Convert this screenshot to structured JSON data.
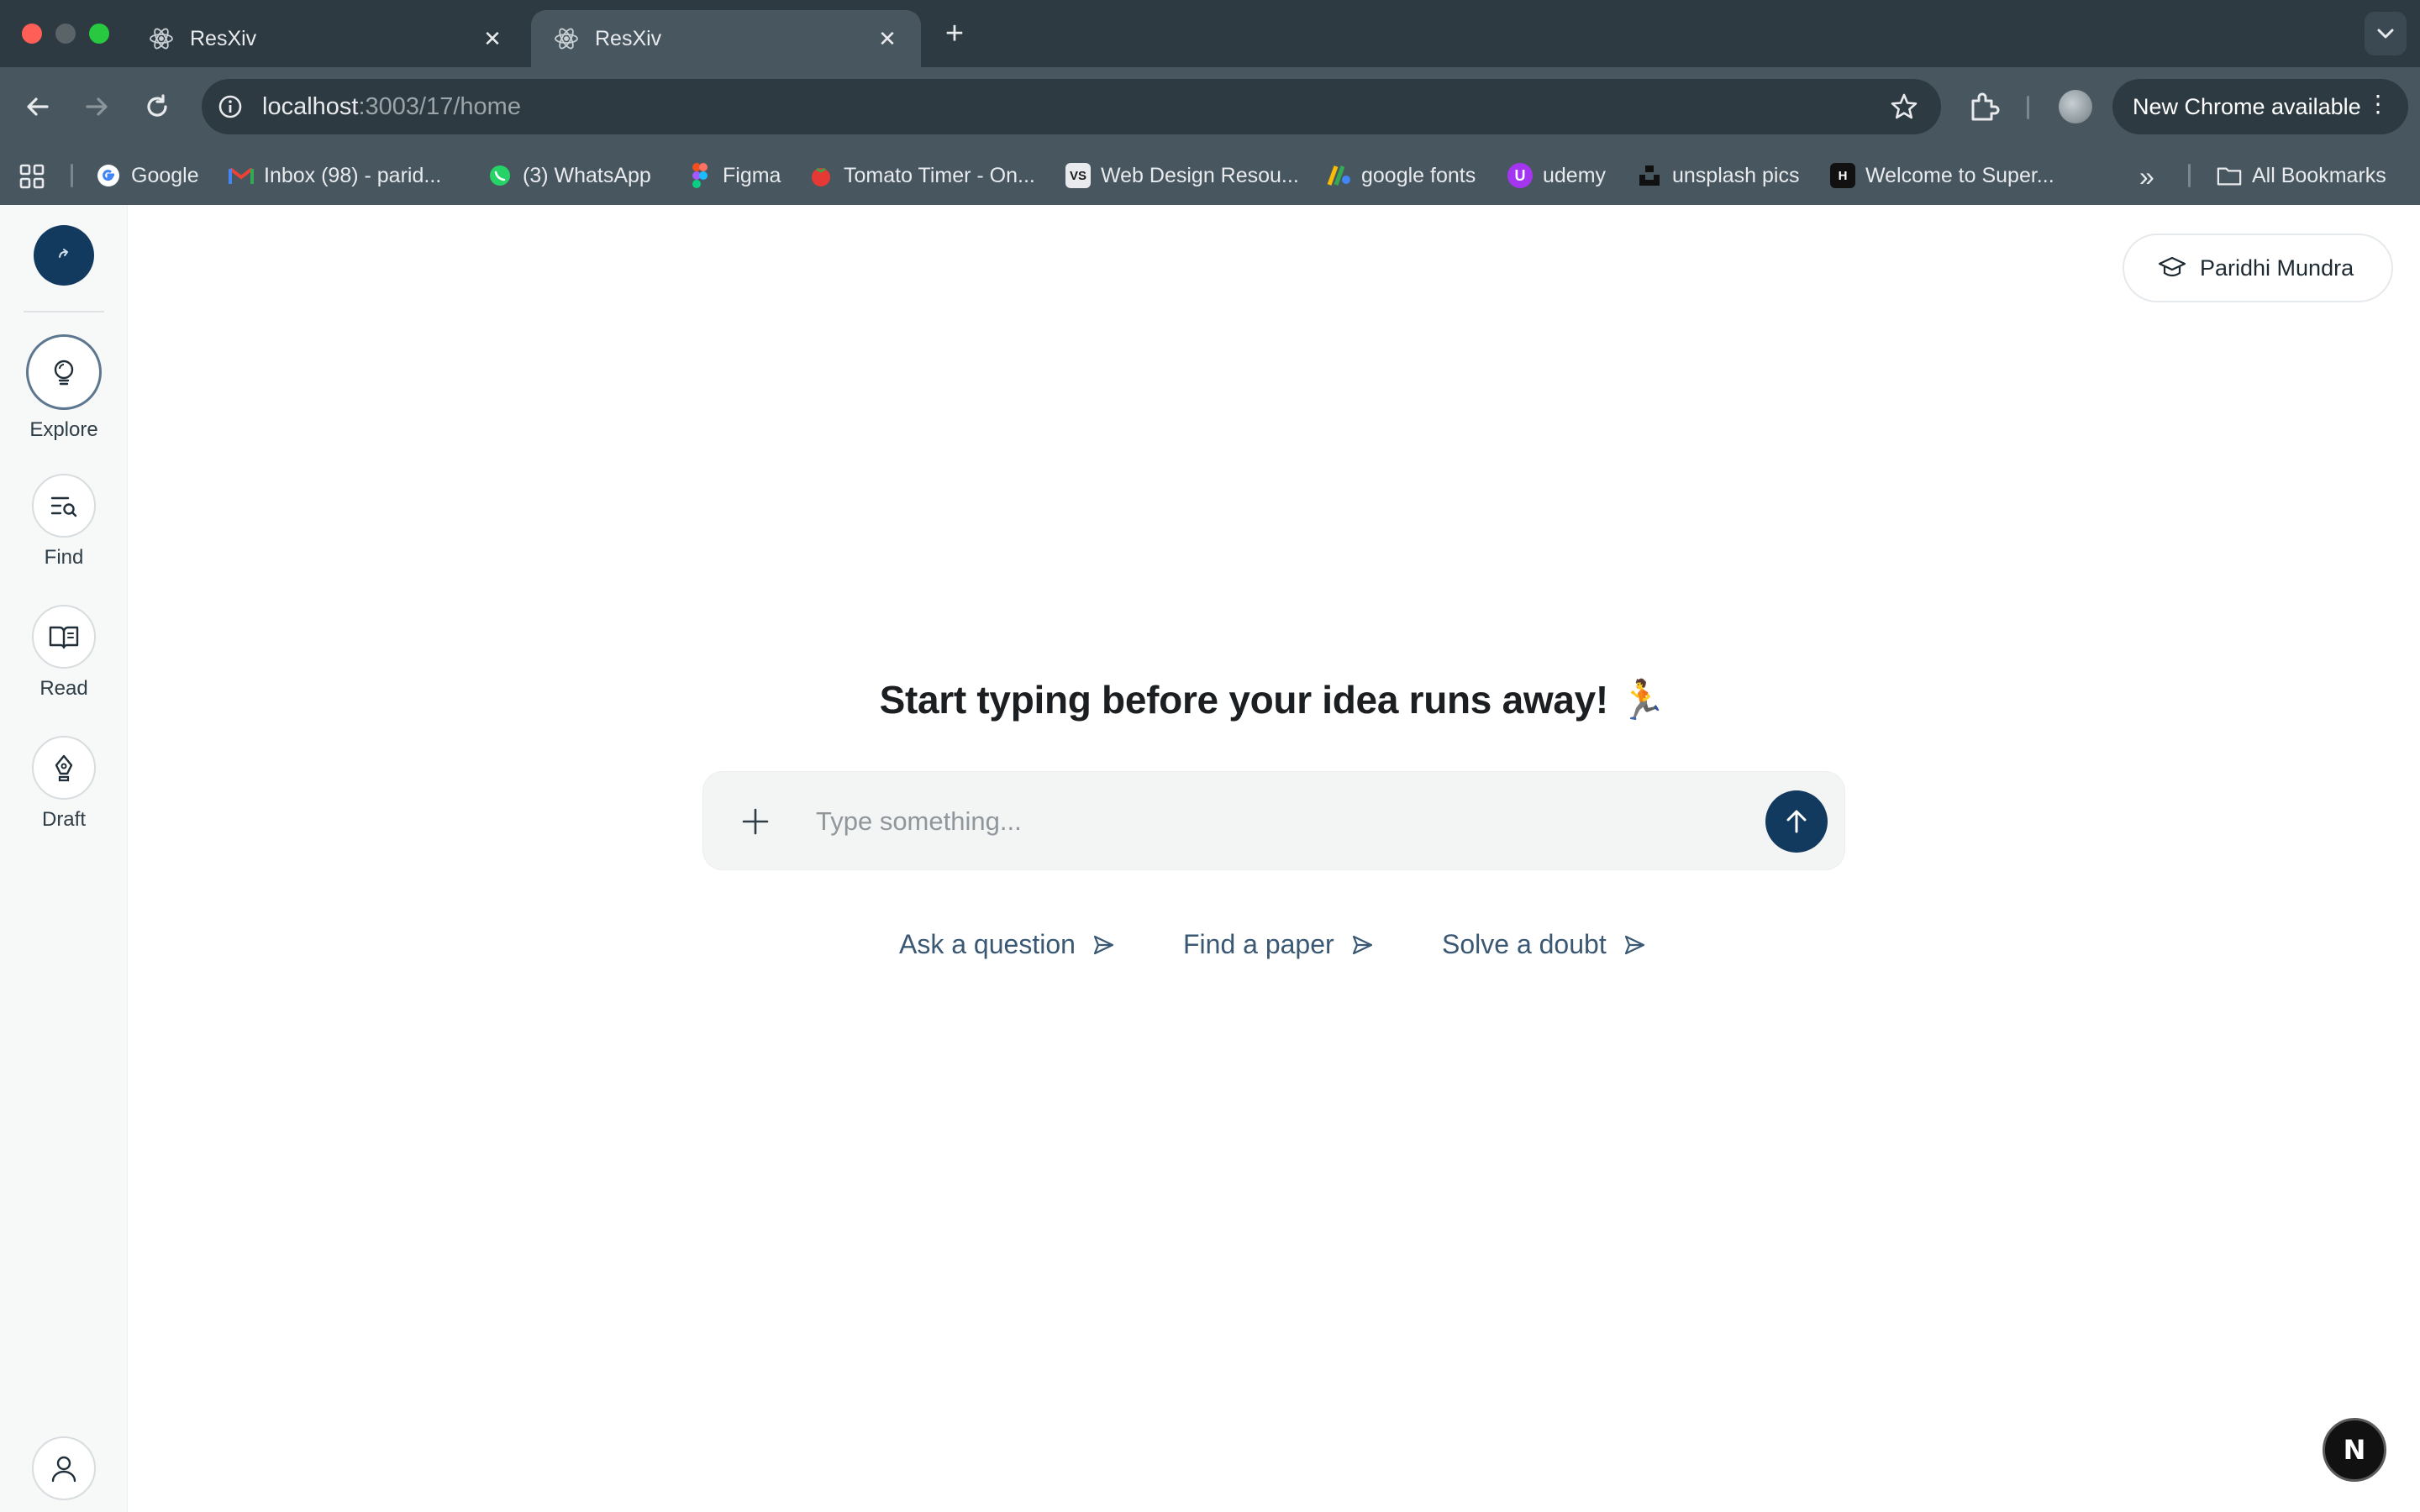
{
  "browser": {
    "tabs": [
      {
        "title": "ResXiv",
        "active": false
      },
      {
        "title": "ResXiv",
        "active": true
      }
    ],
    "url_host": "localhost",
    "url_path": ":3003/17/home",
    "update_label": "New Chrome available",
    "bookmarks": [
      {
        "label": "Google",
        "icon": "google-icon"
      },
      {
        "label": "Inbox (98) - parid...",
        "icon": "gmail-icon"
      },
      {
        "label": "(3) WhatsApp",
        "icon": "whatsapp-icon"
      },
      {
        "label": "Figma",
        "icon": "figma-icon"
      },
      {
        "label": "Tomato Timer - On...",
        "icon": "tomato-icon"
      },
      {
        "label": "Web Design Resou...",
        "icon": "vs-icon"
      },
      {
        "label": "google fonts",
        "icon": "google-fonts-icon"
      },
      {
        "label": "udemy",
        "icon": "udemy-icon"
      },
      {
        "label": "unsplash pics",
        "icon": "unsplash-icon"
      },
      {
        "label": "Welcome to Super...",
        "icon": "superhuman-icon"
      }
    ],
    "all_bookmarks_label": "All Bookmarks"
  },
  "sidebar": {
    "items": [
      {
        "label": "Explore",
        "icon": "lightbulb-icon",
        "active": true
      },
      {
        "label": "Find",
        "icon": "list-search-icon",
        "active": false
      },
      {
        "label": "Read",
        "icon": "book-icon",
        "active": false
      },
      {
        "label": "Draft",
        "icon": "pen-nib-icon",
        "active": false
      }
    ]
  },
  "header": {
    "user_name": "Paridhi Mundra"
  },
  "main": {
    "headline": "Start typing before your idea runs away!",
    "headline_emoji": "🏃",
    "composer": {
      "placeholder": "Type something..."
    },
    "suggestions": [
      "Ask a question",
      "Find a paper",
      "Solve a doubt"
    ]
  },
  "dev_badge": "N",
  "colors": {
    "brand_navy": "#123a5f",
    "link_blue": "#3a5873",
    "chrome_dark": "#2d3a41",
    "chrome_mid": "#48575f"
  }
}
